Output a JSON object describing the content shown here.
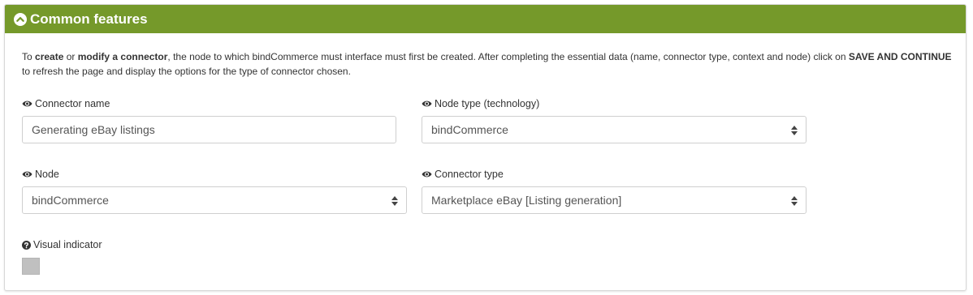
{
  "panel": {
    "title": "Common features",
    "intro": {
      "p1": "To ",
      "b1": "create",
      "p2": " or ",
      "b2": "modify a connector",
      "p3": ", the node to which bindCommerce must interface must first be created. After completing the essential data (name, connector type, context and node) click on ",
      "b3": "SAVE AND CONTINUE",
      "p4": " to refresh the page and display the options for the type of connector chosen."
    }
  },
  "fields": {
    "connector_name": {
      "label": "Connector name",
      "value": "Generating eBay listings"
    },
    "node_type": {
      "label": "Node type (technology)",
      "value": "bindCommerce"
    },
    "node": {
      "label": "Node",
      "value": "bindCommerce"
    },
    "connector_type": {
      "label": "Connector type",
      "value": "Marketplace eBay [Listing generation]"
    },
    "visual_indicator": {
      "label": "Visual indicator",
      "color": "#c0c0c0"
    }
  },
  "colors": {
    "header": "#75992a",
    "header_text": "#ffffff"
  },
  "icons": {
    "header": "chevron-up-circle-icon",
    "visibility": "eye-icon",
    "help": "question-circle-icon",
    "select": "sort-arrows-icon"
  }
}
